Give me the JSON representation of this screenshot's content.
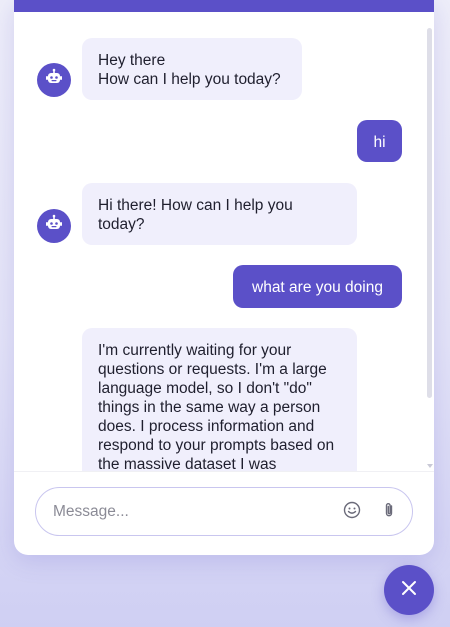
{
  "messages": [
    {
      "role": "bot",
      "text": "Hey there\nHow can I help you today?"
    },
    {
      "role": "user",
      "text": "hi"
    },
    {
      "role": "bot",
      "text": "Hi there! How can I help you today?"
    },
    {
      "role": "user",
      "text": "what are you doing"
    },
    {
      "role": "bot",
      "text": "I'm currently waiting for your questions or requests. I'm a large language model, so I don't \"do\" things in the same way a person does. I process information and respond to your prompts based on the massive dataset I was"
    }
  ],
  "composer": {
    "placeholder": "Message...",
    "value": ""
  },
  "icons": {
    "bot_avatar": "robot-icon",
    "emoji": "smiley-icon",
    "attach": "paperclip-icon",
    "close": "close-icon"
  },
  "colors": {
    "accent": "#5b50c8",
    "bot_bubble": "#f0effc",
    "user_text": "#ffffff"
  }
}
